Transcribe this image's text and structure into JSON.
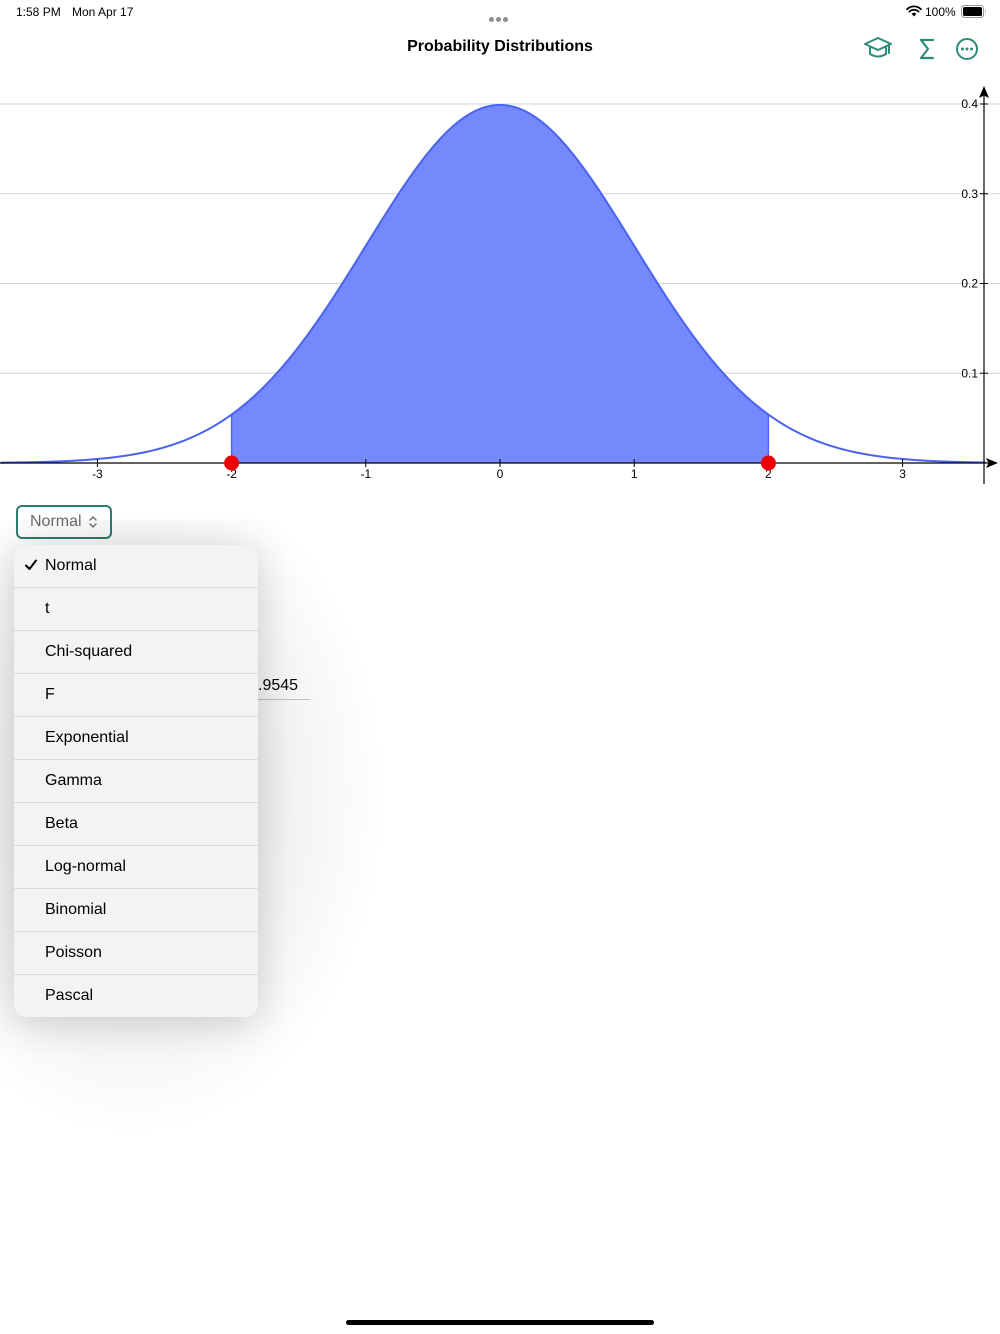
{
  "status_bar": {
    "time": "1:58 PM",
    "date": "Mon Apr 17",
    "battery": "100%"
  },
  "nav": {
    "title": "Probability Distributions",
    "icons": [
      "graduation-cap-icon",
      "sigma-icon",
      "more-circle-icon"
    ],
    "accent_color": "#2f8a78"
  },
  "selector": {
    "value": "Normal"
  },
  "result": {
    "value": ".9545"
  },
  "dropdown": {
    "selected": "Normal",
    "items": [
      "Normal",
      "t",
      "Chi-squared",
      "F",
      "Exponential",
      "Gamma",
      "Beta",
      "Log-normal",
      "Binomial",
      "Poisson",
      "Pascal"
    ]
  },
  "chart_data": {
    "type": "area",
    "distribution": "normal",
    "mean": 0,
    "sd": 1,
    "xlim": [
      -3.72,
      3.62
    ],
    "ylim": [
      0,
      0.4
    ],
    "x_ticks": [
      "-3",
      "-2",
      "-1",
      "0",
      "1",
      "2",
      "3"
    ],
    "y_ticks": [
      "0.1",
      "0.2",
      "0.3",
      "0.4"
    ],
    "shaded_interval": [
      -2,
      2
    ],
    "markers": [
      -2,
      2
    ],
    "fill_color": "#7589fd",
    "line_color": "#4a63f0",
    "marker_color": "#ee0000"
  }
}
